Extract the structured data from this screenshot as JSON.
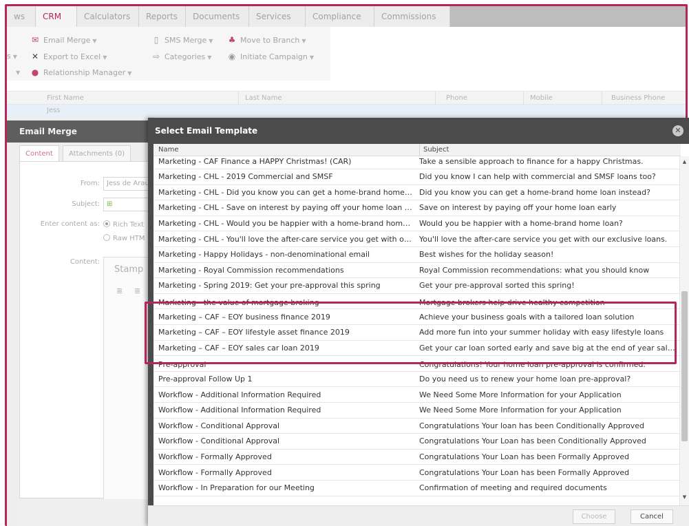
{
  "tabs": [
    "ws",
    "CRM",
    "Calculators",
    "Reports",
    "Documents",
    "Services",
    "Compliance",
    "Commissions"
  ],
  "active_tab": "CRM",
  "ribbon": {
    "email_merge": "Email Merge",
    "sms_merge": "SMS Merge",
    "move_to_branch": "Move to Branch",
    "export_to_excel": "Export to Excel",
    "categories": "Categories",
    "initiate_campaign": "Initiate Campaign",
    "relationship_manager": "Relationship Manager",
    "clipped_left": "s"
  },
  "grid": {
    "columns": [
      "First Name",
      "Last Name",
      "Phone",
      "Mobile",
      "Business Phone"
    ],
    "first_row_first_name": "Jess"
  },
  "email_merge": {
    "title": "Email Merge",
    "tabs": [
      "Content",
      "Attachments (0)"
    ],
    "from_label": "From:",
    "from_value": "Jess de Arau",
    "subject_label": "Subject:",
    "enter_content_label": "Enter content as:",
    "radio_rich": "Rich Text",
    "radio_raw": "Raw HTM",
    "content_label": "Content:",
    "stamp_label": "Stamp"
  },
  "modal": {
    "title": "Select Email Template",
    "columns": {
      "name": "Name",
      "subject": "Subject"
    },
    "rows": [
      {
        "name": "Marketing - CAF Finance a HAPPY Christmas! (CAR)",
        "subject": "Take a sensible approach to finance for a happy Christmas."
      },
      {
        "name": "Marketing - CHL - 2019 Commercial and SMSF",
        "subject": "Did you know I can help with commercial and SMSF loans too?"
      },
      {
        "name": "Marketing - CHL - Did you know you can get a home-brand home loan instead?",
        "subject": "Did you know you can get a home-brand home loan instead?"
      },
      {
        "name": "Marketing - CHL - Save on interest by paying off your home loan early",
        "subject": "Save on interest by paying off your home loan early"
      },
      {
        "name": "Marketing - CHL - Would you be happier with a home-brand home loan?",
        "subject": "Would you be happier with a home-brand home loan?"
      },
      {
        "name": "Marketing - CHL - You'll love the after-care service you get with our exclusive loans",
        "subject": "You'll love the after-care service you get with our exclusive loans."
      },
      {
        "name": "Marketing - Happy Holidays - non-denominational email",
        "subject": "Best wishes for the holiday season!"
      },
      {
        "name": "Marketing - Royal Commission recommendations",
        "subject": "Royal Commission recommendations: what you should know"
      },
      {
        "name": "Marketing - Spring 2019: Get your pre-approval this spring",
        "subject": "Get your pre-approval sorted this spring!"
      },
      {
        "name": "Marketing - the value of mortgage broking",
        "subject": "Mortgage brokers help drive healthy competition"
      },
      {
        "name": "Marketing – CAF – EOY business finance 2019",
        "subject": "Achieve your business goals with a tailored loan solution"
      },
      {
        "name": "Marketing – CAF – EOY lifestyle asset finance 2019",
        "subject": "Add more fun into your summer holiday with easy lifestyle loans"
      },
      {
        "name": "Marketing – CAF – EOY sales car loan 2019",
        "subject": "Get your car loan sorted early and save big at the end of year sales"
      },
      {
        "name": "Pre-approval",
        "subject": "Congratulations! Your home loan pre-approval is confirmed."
      },
      {
        "name": "Pre-approval Follow Up 1",
        "subject": "Do you need us to renew your home loan pre-approval?"
      },
      {
        "name": "Workflow - Additional Information Required",
        "subject": "We Need Some More Information for your Application"
      },
      {
        "name": "Workflow - Additional Information Required",
        "subject": "We Need Some More Information for your Application"
      },
      {
        "name": "Workflow - Conditional Approval",
        "subject": "Congratulations Your loan has been Conditionally Approved"
      },
      {
        "name": "Workflow - Conditional Approval",
        "subject": "Congratulations Your Loan has been Conditionally Approved"
      },
      {
        "name": "Workflow - Formally Approved",
        "subject": "Congratulations Your Loan has been Formally Approved"
      },
      {
        "name": "Workflow - Formally Approved",
        "subject": "Congratulations Your Loan has been Formally Approved"
      },
      {
        "name": "Workflow - In Preparation for our Meeting",
        "subject": "Confirmation of meeting and required documents"
      }
    ],
    "choose_label": "Choose",
    "cancel_label": "Cancel"
  },
  "colors": {
    "accent": "#b5245c",
    "modal_header": "#4b4b4b",
    "panel_header": "#5e5e5e"
  },
  "icons": [
    "email-merge-icon",
    "sms-icon",
    "move-to-branch-icon",
    "excel-icon",
    "categories-icon",
    "campaign-icon",
    "user-icon",
    "close-icon",
    "lookup-icon",
    "indent-icon",
    "outdent-icon"
  ]
}
